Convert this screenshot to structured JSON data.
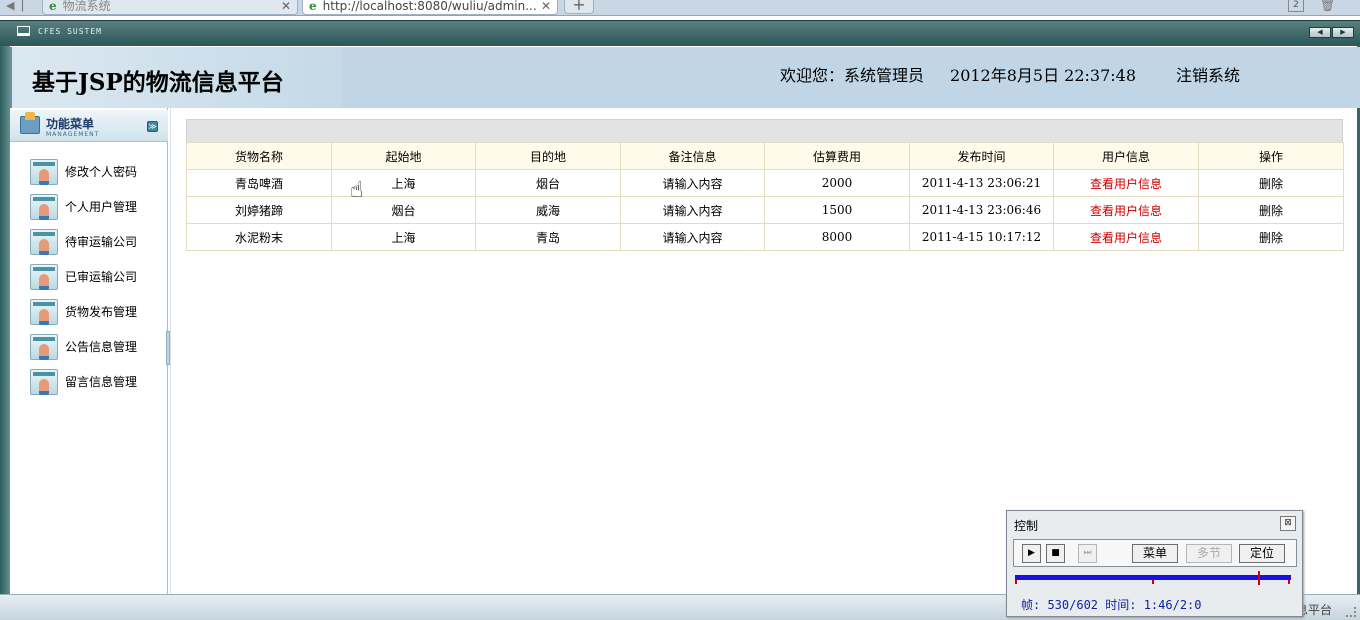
{
  "browser": {
    "tabs": [
      {
        "label": "物流系统",
        "active": false
      },
      {
        "label": "http://localhost:8080/wuliu/admin...",
        "active": true
      }
    ],
    "tab_count": "2"
  },
  "sysbar": {
    "brand": "CFES SUSTEM"
  },
  "header": {
    "title": "基于JSP的物流信息平台",
    "welcome": "欢迎您：系统管理员",
    "datetime": "2012年8月5日  22:37:48",
    "logout": "注销系统"
  },
  "sidebar": {
    "title": "功能菜单",
    "subtitle": "MANAGEMENT",
    "items": [
      {
        "label": "修改个人密码"
      },
      {
        "label": "个人用户管理"
      },
      {
        "label": "待审运输公司"
      },
      {
        "label": "已审运输公司"
      },
      {
        "label": "货物发布管理"
      },
      {
        "label": "公告信息管理"
      },
      {
        "label": "留言信息管理"
      }
    ]
  },
  "table": {
    "columns": [
      "货物名称",
      "起始地",
      "目的地",
      "备注信息",
      "估算费用",
      "发布时间",
      "用户信息",
      "操作"
    ],
    "rows": [
      {
        "name": "青岛啤酒",
        "from": "上海",
        "to": "烟台",
        "note": "请输入内容",
        "cost": "2000",
        "time": "2011-4-13 23:06:21",
        "user_link": "查看用户信息",
        "action": "删除"
      },
      {
        "name": "刘婷猪蹄",
        "from": "烟台",
        "to": "威海",
        "note": "请输入内容",
        "cost": "1500",
        "time": "2011-4-13 23:06:46",
        "user_link": "查看用户信息",
        "action": "删除"
      },
      {
        "name": "水泥粉末",
        "from": "上海",
        "to": "青岛",
        "note": "请输入内容",
        "cost": "8000",
        "time": "2011-4-15 10:17:12",
        "user_link": "查看用户信息",
        "action": "删除"
      }
    ]
  },
  "statusbar": {
    "text": "息平台"
  },
  "control": {
    "title": "控制",
    "menu_label": "菜单",
    "multi_label": "多节",
    "locate_label": "定位",
    "info": "帧: 530/602 时间: 1:46/2:0",
    "progress_fraction": 0.88,
    "colors": {
      "track": "#1c10e0",
      "marker": "#d00000"
    }
  }
}
